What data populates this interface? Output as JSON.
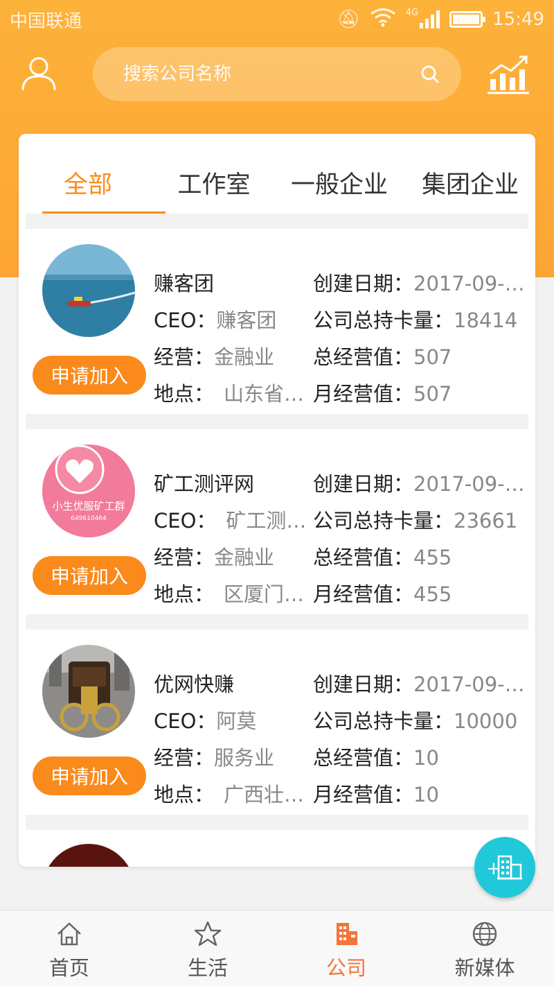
{
  "status_bar": {
    "carrier": "中国联通",
    "time": "15:49",
    "network": "4G"
  },
  "search": {
    "placeholder": "搜索公司名称"
  },
  "tabs": [
    {
      "label": "全部",
      "active": true
    },
    {
      "label": "工作室",
      "active": false
    },
    {
      "label": "一般企业",
      "active": false
    },
    {
      "label": "集团企业",
      "active": false
    }
  ],
  "labels": {
    "ceo": "CEO：",
    "business": "经营：",
    "location": "地点：",
    "created": "创建日期：",
    "cards": "公司总持卡量：",
    "total_value": "总经营值：",
    "monthly_value": "月经营值："
  },
  "companies": [
    {
      "name": "赚客团",
      "ceo": "赚客团",
      "business": "金融业",
      "location": "山东省…",
      "created": "2017-09-…",
      "cards": "18414",
      "total_value": "507",
      "monthly_value": "507",
      "join_label": "申请加入"
    },
    {
      "name": "矿工测评网",
      "ceo": "矿工测…",
      "business": "金融业",
      "location": "区厦门…",
      "created": "2017-09-…",
      "cards": "23661",
      "total_value": "455",
      "monthly_value": "455",
      "join_label": "申请加入",
      "avatar_text": "小生优服矿工群",
      "avatar_subtext": "649610464"
    },
    {
      "name": "优网快赚",
      "ceo": "阿莫",
      "business": "服务业",
      "location": "广西壮…",
      "created": "2017-09-…",
      "cards": "10000",
      "total_value": "10",
      "monthly_value": "10",
      "join_label": "申请加入"
    }
  ],
  "bottom_nav": [
    {
      "label": "首页",
      "icon": "home-icon",
      "active": false
    },
    {
      "label": "生活",
      "icon": "star-icon",
      "active": false
    },
    {
      "label": "公司",
      "icon": "building-icon",
      "active": true
    },
    {
      "label": "新媒体",
      "icon": "globe-icon",
      "active": false
    }
  ],
  "colors": {
    "accent": "#fb8c1d",
    "header": "#fdb23a",
    "fab": "#21c8da",
    "nav_active": "#f2753a"
  }
}
